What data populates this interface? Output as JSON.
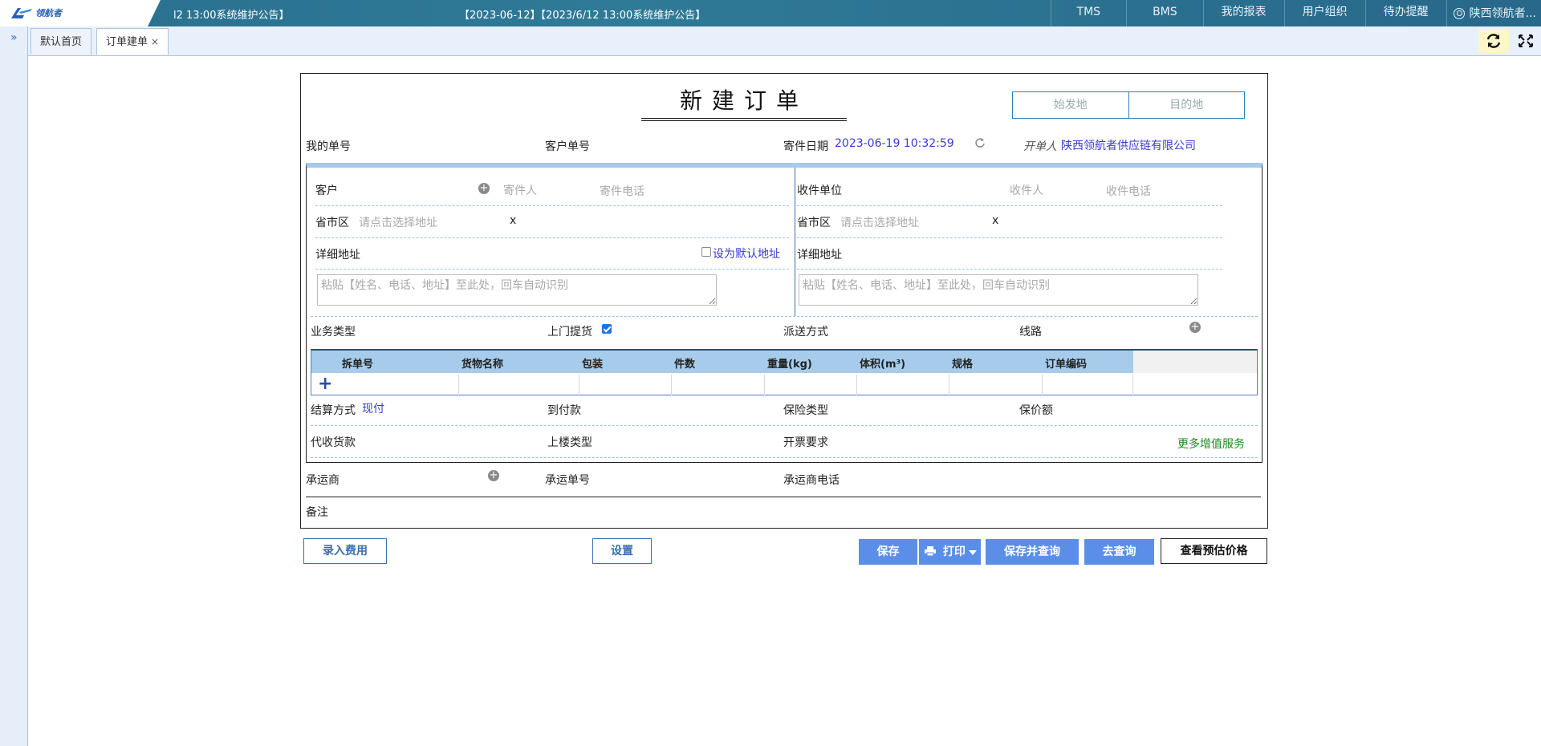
{
  "topbar": {
    "logo_text": "领航者",
    "notice1": "l2 13:00系统维护公告】",
    "notice2": "【2023-06-12】【2023/6/12 13:00系统维护公告】",
    "nav": [
      "TMS",
      "BMS",
      "我的报表",
      "用户组织",
      "待办提醒"
    ],
    "user": "陕西领航者..."
  },
  "tabs": [
    {
      "label": "默认首页"
    },
    {
      "label": "订单建单",
      "close": "×"
    }
  ],
  "form": {
    "title": "新建订单",
    "origin": "始发地",
    "destination": "目的地",
    "my_no_label": "我的单号",
    "cust_no_label": "客户单号",
    "send_date_label": "寄件日期",
    "send_date_value": "2023-06-19 10:32:59",
    "creator_label": "开单人",
    "creator_value": "陕西领航者供应链有限公司",
    "sender": {
      "customer_label": "客户",
      "sender_ph": "寄件人",
      "sender_phone_ph": "寄件电话",
      "region_label": "省市区",
      "region_ph": "请点击选择地址",
      "clear": "x",
      "detail_label": "详细地址",
      "default_addr": "设为默认地址",
      "paste_ph": "粘贴【姓名、电话、地址】至此处，回车自动识别"
    },
    "receiver": {
      "unit_label": "收件单位",
      "receiver_ph": "收件人",
      "receiver_phone_ph": "收件电话",
      "region_label": "省市区",
      "region_ph": "请点击选择地址",
      "clear": "x",
      "detail_label": "详细地址",
      "paste_ph": "粘贴【姓名、电话、地址】至此处，回车自动识别"
    },
    "biz_type_label": "业务类型",
    "pickup_label": "上门提货",
    "pickup_checked": true,
    "delivery_label": "派送方式",
    "route_label": "线路",
    "goods_columns": [
      "拆单号",
      "货物名称",
      "包装",
      "件数",
      "重量(kg)",
      "体积(m³)",
      "规格",
      "订单编码"
    ],
    "settle_label": "结算方式",
    "settle_value": "现付",
    "cod_label": "到付款",
    "insure_type_label": "保险类型",
    "insure_amount_label": "保价额",
    "collect_label": "代收货款",
    "floor_label": "上楼类型",
    "invoice_label": "开票要求",
    "more_services": "更多增值服务",
    "carrier_label": "承运商",
    "carrier_no_label": "承运单号",
    "carrier_phone_label": "承运商电话",
    "remark_label": "备注"
  },
  "buttons": {
    "fee": "录入费用",
    "settings": "设置",
    "save": "保存",
    "print": "打印",
    "save_query": "保存并查询",
    "query": "去查询",
    "estimate": "查看预估价格"
  },
  "colors": {
    "topbar": "#2f7a97",
    "accent": "#5b8ee8",
    "header_row": "#a7cbea",
    "link": "#3a3ad8"
  }
}
